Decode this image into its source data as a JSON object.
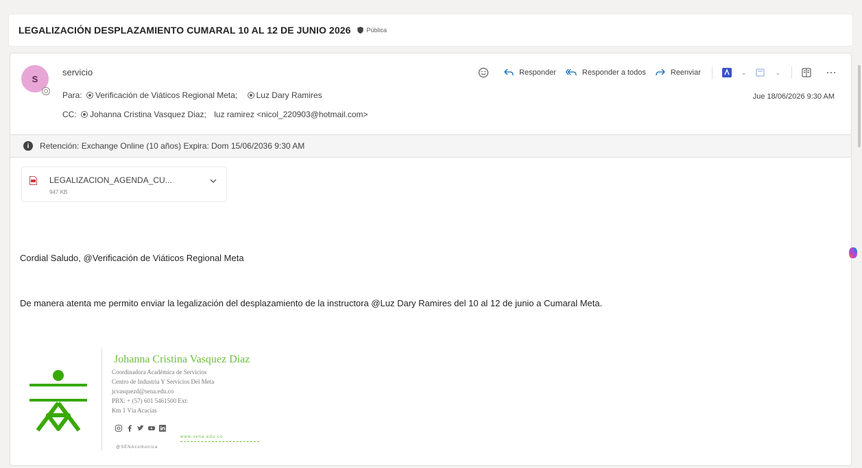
{
  "subject": {
    "title": "LEGALIZACIÓN DESPLAZAMIENTO CUMARAL 10 AL 12 DE JUNIO 2026",
    "sensitivity": "Pública"
  },
  "message": {
    "avatar_initial": "S",
    "sender": "servicio",
    "to_label": "Para:",
    "to": [
      "Verificación de Viáticos Regional Meta;",
      "Luz Dary Ramires"
    ],
    "cc_label": "CC:",
    "cc": [
      "Johanna Cristina Vasquez Diaz;",
      "luz ramirez <nicol_220903@hotmail.com>"
    ],
    "date": "Jue 18/06/2026 9:30 AM"
  },
  "actions": {
    "reply": "Responder",
    "reply_all": "Responder a todos",
    "forward": "Reenviar"
  },
  "retention": {
    "text": "Retención: Exchange Online (10 años) Expira: Dom 15/06/2036 9:30 AM"
  },
  "attachment": {
    "name": "LEGALIZACION_AGENDA_CU...",
    "size": "947 KB"
  },
  "body": {
    "greeting": "Cordial Saludo, @Verificación de Viáticos Regional Meta",
    "paragraph": "De manera atenta me permito enviar la legalización del desplazamiento de la instructora @Luz Dary Ramires del 10 al 12 de junio a Cumaral Meta."
  },
  "signature": {
    "logo_text": "SENA",
    "name": "Johanna Cristina Vasquez Diaz",
    "role": "Coordinadora Académica de Servicios",
    "center": "Centro de Industria Y Servicios Del Meta",
    "email": "jcvasquezd@sena.edu.co",
    "phone": "PBX: + (57) 601 5461500 Ext:",
    "address": "Km 1 Vía Acacías",
    "website": "www.sena.edu.co",
    "handle": "@SENAcomunica"
  },
  "colors": {
    "sena_green": "#39a900",
    "avatar_bg": "#e8a6d7",
    "accent": "#0f6cbd"
  }
}
